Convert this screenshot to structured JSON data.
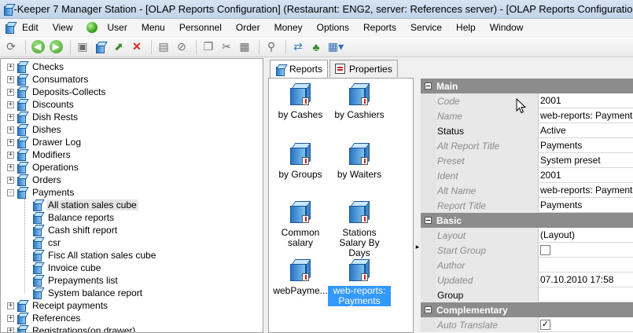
{
  "window": {
    "title": "R-Keeper 7 Manager Station - [OLAP Reports Configuration] (Restaurant: ENG2, server: References server) - [OLAP Reports Configuration]"
  },
  "menu": {
    "items": [
      {
        "label": "Edit"
      },
      {
        "label": "View"
      },
      {
        "label": "User"
      },
      {
        "label": "Menu"
      },
      {
        "label": "Personnel"
      },
      {
        "label": "Order"
      },
      {
        "label": "Money"
      },
      {
        "label": "Options"
      },
      {
        "label": "Reports"
      },
      {
        "label": "Service"
      },
      {
        "label": "Help"
      },
      {
        "label": "Window"
      }
    ]
  },
  "tree": {
    "items": [
      {
        "label": "Checks",
        "level": 0,
        "expander": "+"
      },
      {
        "label": "Consumators",
        "level": 0,
        "expander": "+"
      },
      {
        "label": "Deposits-Collects",
        "level": 0,
        "expander": "+"
      },
      {
        "label": "Discounts",
        "level": 0,
        "expander": "+"
      },
      {
        "label": "Dish Rests",
        "level": 0,
        "expander": "+"
      },
      {
        "label": "Dishes",
        "level": 0,
        "expander": "+"
      },
      {
        "label": "Drawer Log",
        "level": 0,
        "expander": "+"
      },
      {
        "label": "Modifiers",
        "level": 0,
        "expander": "+"
      },
      {
        "label": "Operations",
        "level": 0,
        "expander": "+"
      },
      {
        "label": "Orders",
        "level": 0,
        "expander": "+"
      },
      {
        "label": "Payments",
        "level": 0,
        "expander": "-"
      },
      {
        "label": "All station sales cube",
        "level": 1,
        "expander": "",
        "selected": true
      },
      {
        "label": "Balance reports",
        "level": 1,
        "expander": ""
      },
      {
        "label": "Cash shift report",
        "level": 1,
        "expander": ""
      },
      {
        "label": "csr",
        "level": 1,
        "expander": ""
      },
      {
        "label": "Fisc All station sales cube",
        "level": 1,
        "expander": ""
      },
      {
        "label": "Invoice cube",
        "level": 1,
        "expander": ""
      },
      {
        "label": "Prepayments list",
        "level": 1,
        "expander": ""
      },
      {
        "label": "System balance report",
        "level": 1,
        "expander": ""
      },
      {
        "label": "Receipt payments",
        "level": 0,
        "expander": "+"
      },
      {
        "label": "References",
        "level": 0,
        "expander": "+"
      },
      {
        "label": "Registrations(on drawer)",
        "level": 0,
        "expander": "+"
      }
    ]
  },
  "tabs": [
    {
      "label": "Reports",
      "active": true
    },
    {
      "label": "Properties",
      "active": false
    }
  ],
  "reports": [
    {
      "label": "by Cashes"
    },
    {
      "label": "by Cashiers"
    },
    {
      "label": "by Groups"
    },
    {
      "label": "by Waiters"
    },
    {
      "label": "Common salary"
    },
    {
      "label": "Stations Salary By Days"
    },
    {
      "label": "webPayme..."
    },
    {
      "label": "web-reports: Payments",
      "selected": true
    }
  ],
  "props": {
    "main_label": "Main",
    "basic_label": "Basic",
    "comp_label": "Complementary",
    "main": [
      {
        "name": "Code",
        "value": "2001",
        "muted": true
      },
      {
        "name": "Name",
        "value": "web-reports: Payments",
        "muted": true
      },
      {
        "name": "Status",
        "value": "Active",
        "muted": false
      },
      {
        "name": "Alt Report Title",
        "value": "Payments",
        "muted": true
      },
      {
        "name": "Preset",
        "value": "System preset",
        "muted": true
      },
      {
        "name": "Ident",
        "value": "2001",
        "muted": true
      },
      {
        "name": "Alt Name",
        "value": "web-reports: Payments",
        "muted": true
      },
      {
        "name": "Report Title",
        "value": "Payments",
        "muted": true
      }
    ],
    "basic": [
      {
        "name": "Layout",
        "value": "(Layout)",
        "muted": true
      },
      {
        "name": "Start Group",
        "value": "",
        "muted": true,
        "checkbox": true,
        "checked": false
      },
      {
        "name": "Author",
        "value": "",
        "muted": true
      },
      {
        "name": "Updated",
        "value": "07.10.2010 17:58",
        "muted": true
      },
      {
        "name": "Group",
        "value": "",
        "muted": false
      }
    ],
    "comp": [
      {
        "name": "Auto Translate",
        "value": "",
        "muted": true,
        "checkbox": true,
        "checked": true
      }
    ]
  }
}
